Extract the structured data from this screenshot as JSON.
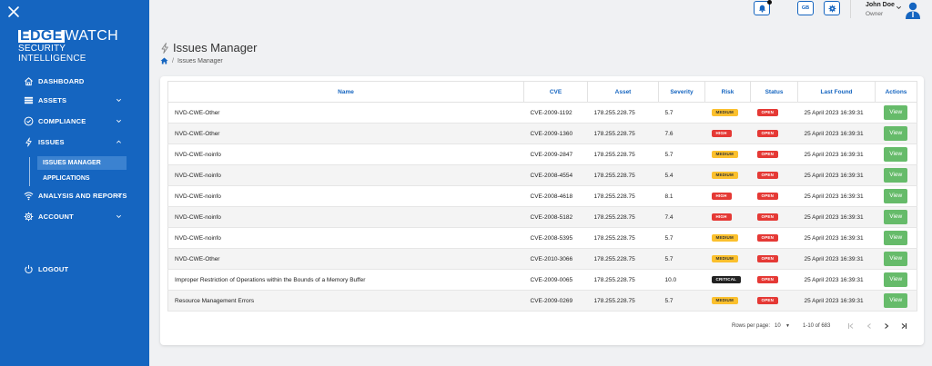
{
  "brand": {
    "name_part1": "EDGE",
    "name_part2": "WATCH",
    "tagline": "SECURITY INTELLIGENCE"
  },
  "sidebar": {
    "items": [
      {
        "label": "DASHBOARD",
        "icon": "home-icon"
      },
      {
        "label": "ASSETS",
        "icon": "list-icon"
      },
      {
        "label": "COMPLIANCE",
        "icon": "check-circle-icon"
      },
      {
        "label": "ISSUES",
        "icon": "bolt-icon"
      },
      {
        "label": "ANALYSIS AND REPORTS",
        "icon": "wifi-icon"
      },
      {
        "label": "ACCOUNT",
        "icon": "gear-icon"
      }
    ],
    "subitems": [
      {
        "label": "ISSUES MANAGER"
      },
      {
        "label": "APPLICATIONS"
      }
    ],
    "logout_label": "LOGOUT"
  },
  "topbar": {
    "lang_label": "GB",
    "user_name": "John Doe",
    "user_role": "Owner"
  },
  "page": {
    "title": "Issues Manager",
    "breadcrumb_sep": "/",
    "breadcrumb_current": "Issues Manager"
  },
  "table": {
    "headers": [
      "Name",
      "CVE",
      "Asset",
      "Severity",
      "Risk",
      "Status",
      "Last Found",
      "Actions"
    ],
    "view_label": "View",
    "rows": [
      {
        "name": "NVD-CWE-Other",
        "cve": "CVE-2009-1192",
        "asset": "178.255.228.75",
        "severity": "5.7",
        "risk": "MEDIUM",
        "status": "OPEN",
        "last_found": "25 April 2023 16:39:31"
      },
      {
        "name": "NVD-CWE-Other",
        "cve": "CVE-2009-1360",
        "asset": "178.255.228.75",
        "severity": "7.6",
        "risk": "HIGH",
        "status": "OPEN",
        "last_found": "25 April 2023 16:39:31"
      },
      {
        "name": "NVD-CWE-noinfo",
        "cve": "CVE-2009-2847",
        "asset": "178.255.228.75",
        "severity": "5.7",
        "risk": "MEDIUM",
        "status": "OPEN",
        "last_found": "25 April 2023 16:39:31"
      },
      {
        "name": "NVD-CWE-noinfo",
        "cve": "CVE-2008-4554",
        "asset": "178.255.228.75",
        "severity": "5.4",
        "risk": "MEDIUM",
        "status": "OPEN",
        "last_found": "25 April 2023 16:39:31"
      },
      {
        "name": "NVD-CWE-noinfo",
        "cve": "CVE-2008-4618",
        "asset": "178.255.228.75",
        "severity": "8.1",
        "risk": "HIGH",
        "status": "OPEN",
        "last_found": "25 April 2023 16:39:31"
      },
      {
        "name": "NVD-CWE-noinfo",
        "cve": "CVE-2008-5182",
        "asset": "178.255.228.75",
        "severity": "7.4",
        "risk": "HIGH",
        "status": "OPEN",
        "last_found": "25 April 2023 16:39:31"
      },
      {
        "name": "NVD-CWE-noinfo",
        "cve": "CVE-2008-5395",
        "asset": "178.255.228.75",
        "severity": "5.7",
        "risk": "MEDIUM",
        "status": "OPEN",
        "last_found": "25 April 2023 16:39:31"
      },
      {
        "name": "NVD-CWE-Other",
        "cve": "CVE-2010-3066",
        "asset": "178.255.228.75",
        "severity": "5.7",
        "risk": "MEDIUM",
        "status": "OPEN",
        "last_found": "25 April 2023 16:39:31"
      },
      {
        "name": "Improper Restriction of Operations within the Bounds of a Memory Buffer",
        "cve": "CVE-2009-0065",
        "asset": "178.255.228.75",
        "severity": "10.0",
        "risk": "CRITICAL",
        "status": "OPEN",
        "last_found": "25 April 2023 16:39:31"
      },
      {
        "name": "Resource Management Errors",
        "cve": "CVE-2009-0269",
        "asset": "178.255.228.75",
        "severity": "5.7",
        "risk": "MEDIUM",
        "status": "OPEN",
        "last_found": "25 April 2023 16:39:31"
      }
    ]
  },
  "pagination": {
    "rows_per_page_label": "Rows per page:",
    "rows_per_page": "10",
    "range": "1-10 of 683"
  },
  "colors": {
    "sidebar": "#1565c0",
    "accent": "#1565c0",
    "medium": "#fbc02d",
    "high": "#e53935",
    "critical": "#222222",
    "view": "#66bb6a"
  }
}
